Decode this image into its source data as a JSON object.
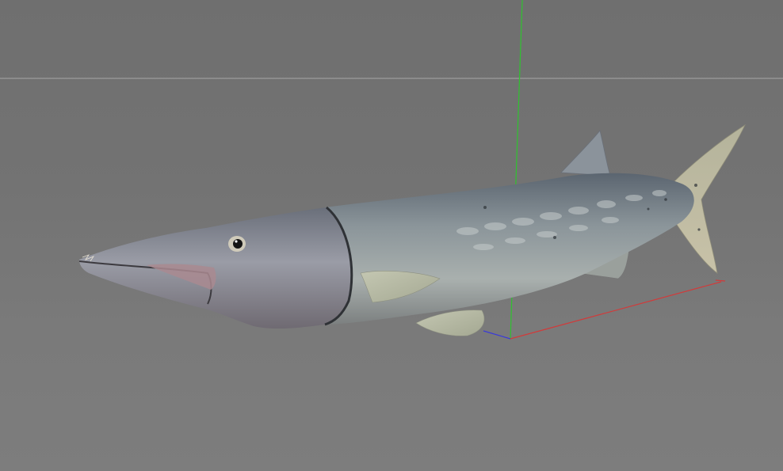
{
  "viewport": {
    "background": "#737373",
    "horizon_color": "#a6a6a6"
  },
  "axes": {
    "x_color": "#d23a3a",
    "y_color": "#2fc22f",
    "z_color": "#3a3ad8"
  },
  "model": {
    "object": "fish-model",
    "body_color": "#8e979c",
    "belly_color": "#b6bcba",
    "back_color": "#5c6670",
    "fin_color": "#b9bba4"
  }
}
